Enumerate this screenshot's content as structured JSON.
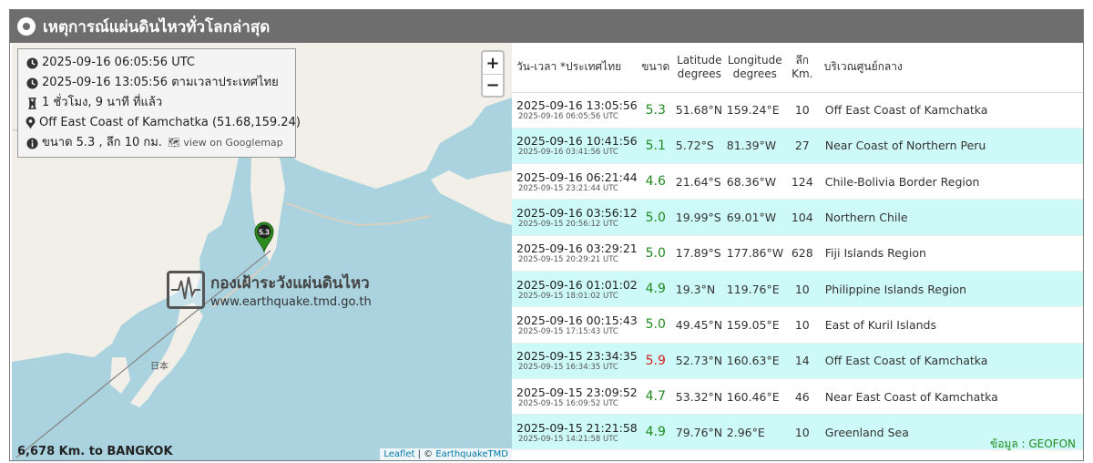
{
  "title": "เหตุการณ์แผ่นดินไหวทั่วโลกล่าสุด",
  "latest": {
    "utc": "2025-09-16 06:05:56 UTC",
    "thai_time": "2025-09-16 13:05:56 ตามเวลาประเทศไทย",
    "ago": "1 ชั่วโมง, 9 นาที ที่แล้ว",
    "location": "Off East Coast of Kamchatka (51.68,159.24)",
    "magnitude_depth": "ขนาด 5.3 , ลึก 10 กม.",
    "googlemap_link": "view on Googlemap",
    "marker_mag": "5.3"
  },
  "map": {
    "zoom_in": "+",
    "zoom_out": "−",
    "watermark_title": "กองเฝ้าระวังแผ่นดินไหว",
    "watermark_url": "www.earthquake.tmd.go.th",
    "label_japan": "日本",
    "distance": "6,678 Km. to BANGKOK",
    "attribution_leaflet": "Leaflet",
    "attribution_sep": "| ©",
    "attribution_source": "EarthquakeTMD"
  },
  "table": {
    "headers": {
      "datetime": "วัน-เวลา *ประเทศไทย",
      "magnitude": "ขนาด",
      "latitude": "Latitude degrees",
      "longitude": "Longitude degrees",
      "depth": "ลึก Km.",
      "region": "บริเวณศูนย์กลาง"
    },
    "rows": [
      {
        "thai": "2025-09-16 13:05:56",
        "utc": "2025-09-16 06:05:56 UTC",
        "mag": "5.3",
        "lat": "51.68°N",
        "lon": "159.24°E",
        "depth": "10",
        "region": "Off East Coast of Kamchatka"
      },
      {
        "thai": "2025-09-16 10:41:56",
        "utc": "2025-09-16 03:41:56 UTC",
        "mag": "5.1",
        "lat": "5.72°S",
        "lon": "81.39°W",
        "depth": "27",
        "region": "Near Coast of Northern Peru"
      },
      {
        "thai": "2025-09-16 06:21:44",
        "utc": "2025-09-15 23:21:44 UTC",
        "mag": "4.6",
        "lat": "21.64°S",
        "lon": "68.36°W",
        "depth": "124",
        "region": "Chile-Bolivia Border Region"
      },
      {
        "thai": "2025-09-16 03:56:12",
        "utc": "2025-09-15 20:56:12 UTC",
        "mag": "5.0",
        "lat": "19.99°S",
        "lon": "69.01°W",
        "depth": "104",
        "region": "Northern Chile"
      },
      {
        "thai": "2025-09-16 03:29:21",
        "utc": "2025-09-15 20:29:21 UTC",
        "mag": "5.0",
        "lat": "17.89°S",
        "lon": "177.86°W",
        "depth": "628",
        "region": "Fiji Islands Region"
      },
      {
        "thai": "2025-09-16 01:01:02",
        "utc": "2025-09-15 18:01:02 UTC",
        "mag": "4.9",
        "lat": "19.3°N",
        "lon": "119.76°E",
        "depth": "10",
        "region": "Philippine Islands Region"
      },
      {
        "thai": "2025-09-16 00:15:43",
        "utc": "2025-09-15 17:15:43 UTC",
        "mag": "5.0",
        "lat": "49.45°N",
        "lon": "159.05°E",
        "depth": "10",
        "region": "East of Kuril Islands"
      },
      {
        "thai": "2025-09-15 23:34:35",
        "utc": "2025-09-15 16:34:35 UTC",
        "mag": "5.9",
        "lat": "52.73°N",
        "lon": "160.63°E",
        "depth": "14",
        "region": "Off East Coast of Kamchatka"
      },
      {
        "thai": "2025-09-15 23:09:52",
        "utc": "2025-09-15 16:09:52 UTC",
        "mag": "4.7",
        "lat": "53.32°N",
        "lon": "160.46°E",
        "depth": "46",
        "region": "Near East Coast of Kamchatka"
      },
      {
        "thai": "2025-09-15 21:21:58",
        "utc": "2025-09-15 14:21:58 UTC",
        "mag": "4.9",
        "lat": "79.76°N",
        "lon": "2.96°E",
        "depth": "10",
        "region": "Greenland Sea"
      }
    ]
  },
  "source": "ข้อมูล : GEOFON",
  "colors": {
    "titlebar": "#6e6e6e",
    "alt_row": "#cdfaf8",
    "mag_normal": "#1f8a1f",
    "mag_high": "#d21f1f",
    "water": "#aad3df",
    "land": "#f2efe9",
    "marker": "#2e8b1f"
  },
  "icons": {
    "title": "radio-dot-icon",
    "utc": "clock-icon",
    "thai_time": "clock-icon",
    "ago": "hourglass-icon",
    "location": "map-pin-icon",
    "info": "info-icon",
    "googlemap": "map-icon"
  }
}
